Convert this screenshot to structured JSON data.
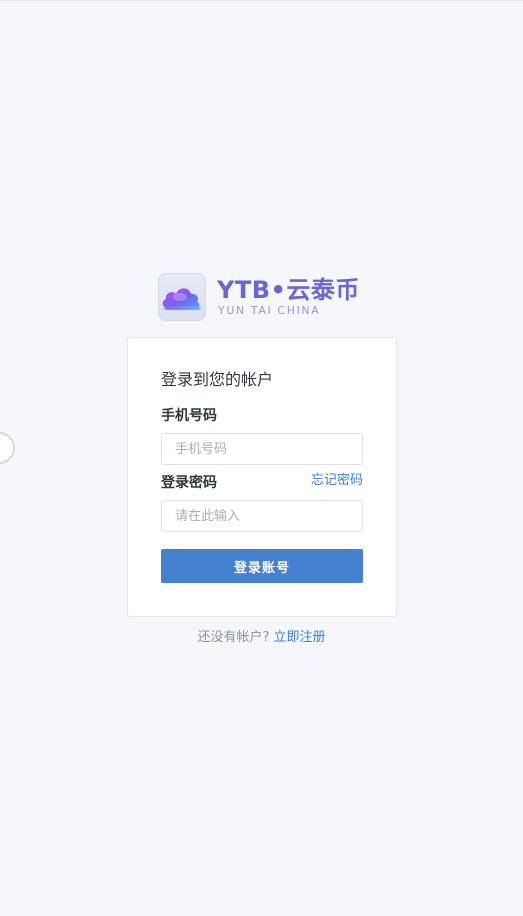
{
  "logo": {
    "title": "YTB•云泰币",
    "subtitle": "YUN TAI CHINA",
    "icon": "cloud-icon"
  },
  "login": {
    "title": "登录到您的帐户",
    "phone_label": "手机号码",
    "phone_placeholder": "手机号码",
    "phone_value": "",
    "password_label": "登录密码",
    "password_placeholder": "请在此输入",
    "password_value": "",
    "forgot_label": "忘记密码",
    "submit_label": "登录账号"
  },
  "register": {
    "prompt": "还没有帐户?",
    "link_label": "立即注册"
  },
  "colors": {
    "accent": "#4680d0",
    "link": "#3d7fd6",
    "logo": "#6a66d4",
    "background": "#f5f7fb"
  }
}
